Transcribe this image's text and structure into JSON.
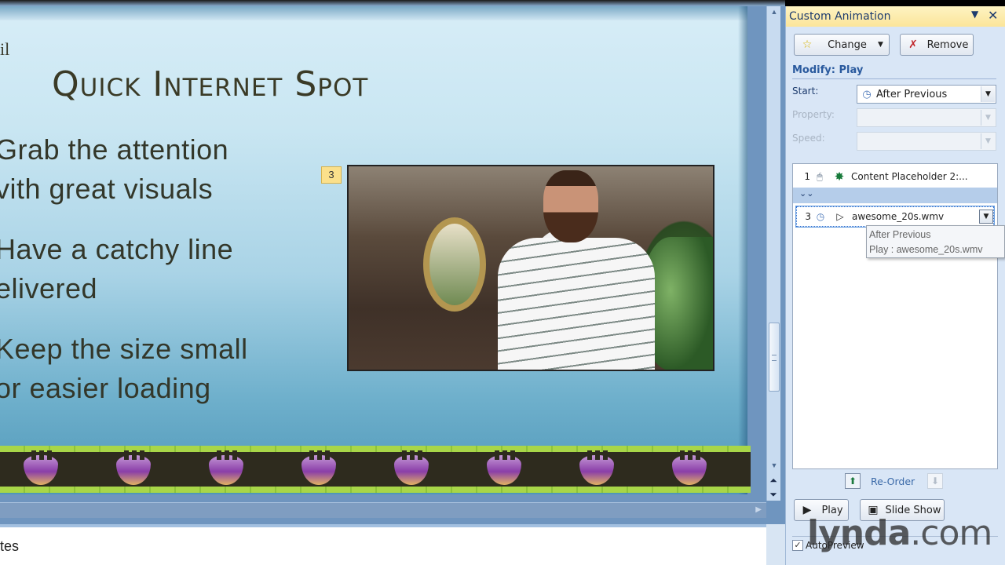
{
  "slide": {
    "edge_text": "il",
    "title": "Quick Internet Spot",
    "bullets": [
      [
        "Grab the attention",
        "with great visuals"
      ],
      [
        "Have a catchy line",
        "delivered"
      ],
      [
        "Keep the size small",
        "for easier loading"
      ]
    ],
    "bullet_lines_visible": [
      [
        "Grab the attention",
        "vith great  visuals"
      ],
      [
        "Have a catchy line",
        "elivered"
      ],
      [
        "Keep the size small",
        "or easier  loading"
      ]
    ],
    "animation_tag": "3",
    "video_file": "awesome_20s.wmv",
    "tulip_count": 8
  },
  "notes": {
    "text": "tes"
  },
  "task_pane": {
    "title": "Custom Animation",
    "menu_icon": "dropdown-triangle-icon",
    "close_icon": "close-icon",
    "change_button": {
      "label": "Change",
      "icon": "add-effect-star-icon"
    },
    "remove_button": {
      "label": "Remove",
      "icon": "remove-effect-icon"
    },
    "modify_label": "Modify: Play",
    "start": {
      "label": "Start:",
      "value": "After Previous",
      "icon": "clock-icon"
    },
    "property": {
      "label": "Property:",
      "value": ""
    },
    "speed": {
      "label": "Speed:",
      "value": ""
    },
    "animation_list": [
      {
        "order": "1",
        "trigger_icon": "mouse-click-icon",
        "effect_icon": "entrance-star-icon",
        "name": "Content Placeholder 2:..."
      },
      {
        "order": "3",
        "trigger_icon": "clock-icon",
        "effect_icon": "play-triangle-icon",
        "name": "awesome_20s.wmv",
        "selected": true
      }
    ],
    "tooltip": {
      "line1": "After Previous",
      "line2": "Play : awesome_20s.wmv"
    },
    "reorder_label": "Re-Order",
    "play_button": "Play",
    "slideshow_button": "Slide Show",
    "autopreview_label": "AutoPreview",
    "autopreview_checked": true
  },
  "watermark": {
    "brand": "lynda",
    "suffix": ".com"
  },
  "colors": {
    "pane_header": "#fbe59a",
    "pane_bg": "#d9e6f6",
    "modify_label": "#2a5a9e",
    "anim_tag": "#fbe08b",
    "tulip": "#8a3ea8",
    "band_green": "#a8d648"
  }
}
